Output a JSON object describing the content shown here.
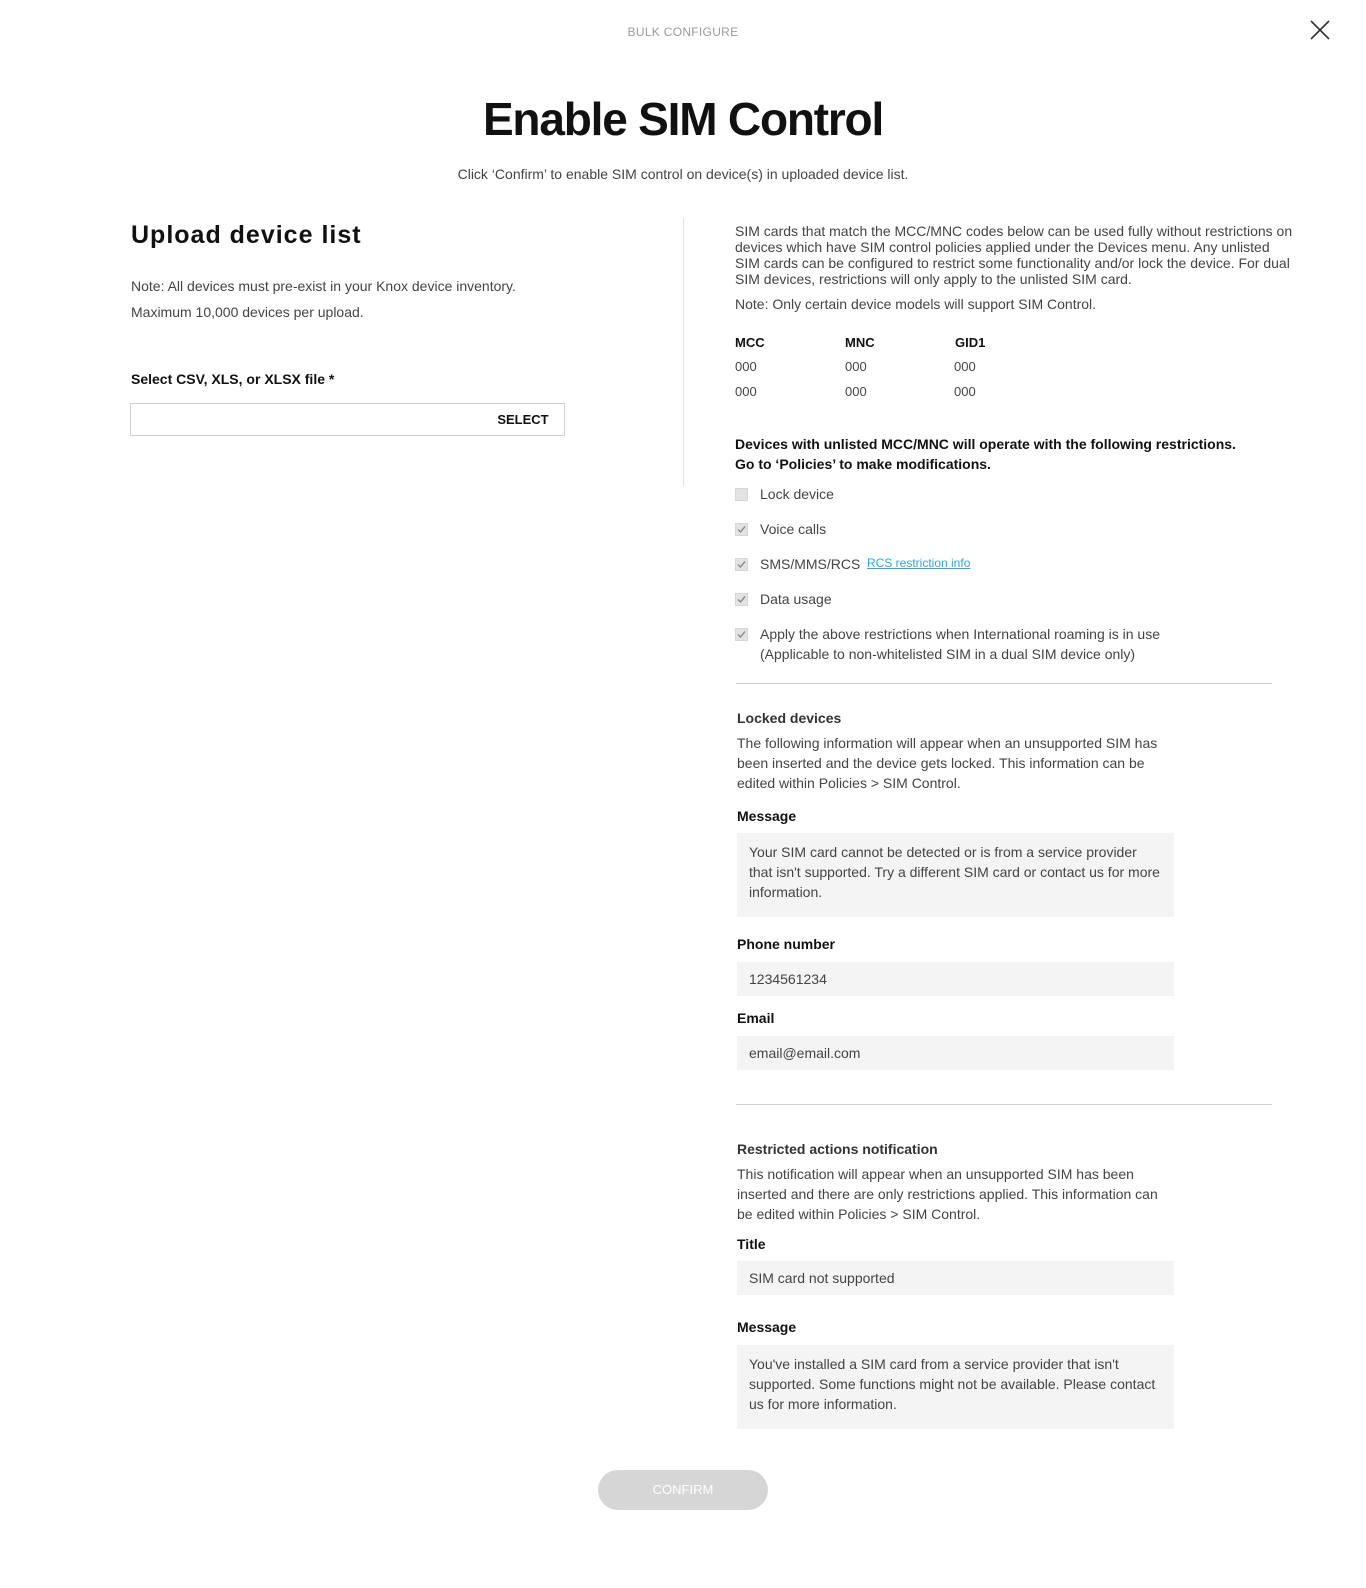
{
  "header": {
    "eyebrow": "BULK CONFIGURE",
    "title": "Enable SIM Control",
    "subtitle": "Click ‘Confirm’ to enable SIM control on device(s) in uploaded device list.",
    "close_icon": "close-icon"
  },
  "upload": {
    "heading": "Upload device list",
    "note1": "Note: All devices must pre-exist in your Knox device inventory.",
    "note2": "Maximum 10,000 devices per upload.",
    "file_label": "Select CSV, XLS, or XLSX file *",
    "file_value": "",
    "select_label": "SELECT"
  },
  "sim": {
    "intro": "SIM cards that match the MCC/MNC codes below can be used fully without restrictions on devices which have SIM control policies applied under the Devices menu. Any unlisted SIM cards can be configured to restrict some functionality and/or lock the device. For dual SIM devices, restrictions will only apply to the unlisted SIM card.",
    "note": "Note: Only certain device models will support SIM Control.",
    "table": {
      "headers": [
        "MCC",
        "MNC",
        "GID1"
      ],
      "rows": [
        [
          "000",
          "000",
          "000"
        ],
        [
          "000",
          "000",
          "000"
        ]
      ]
    }
  },
  "restrictions": {
    "heading_line1": "Devices with unlisted MCC/MNC will operate with the following restrictions.",
    "heading_line2": "Go to ‘Policies’ to make modifications.",
    "items": [
      {
        "label": "Lock device",
        "checked": false
      },
      {
        "label": "Voice calls",
        "checked": true
      },
      {
        "label": "SMS/MMS/RCS",
        "checked": true
      },
      {
        "label": "Data usage",
        "checked": true
      },
      {
        "label": "Apply the above restrictions when International roaming is in use",
        "sublabel": "(Applicable to non-whitelisted SIM in a dual SIM device only)",
        "checked": true
      }
    ],
    "rcs_link": "RCS restriction info"
  },
  "locked": {
    "title": "Locked devices",
    "desc": "The following information will appear when an unsupported SIM has been inserted and the device gets locked. This information can be edited within Policies > SIM Control.",
    "message_label": "Message",
    "message_value": "Your SIM card cannot be detected or is from a service provider that isn't supported. Try a different SIM card or contact us for more information.",
    "phone_label": "Phone number",
    "phone_value": "1234561234",
    "email_label": "Email",
    "email_value": "email@email.com"
  },
  "notification": {
    "title": "Restricted actions notification",
    "desc": "This notification will appear when an unsupported SIM has been inserted and there are only restrictions applied. This information can be edited within Policies > SIM Control.",
    "title_label": "Title",
    "title_value": "SIM card not supported",
    "message_label": "Message",
    "message_value": "You've installed a SIM card from a service provider that isn't supported. Some functions might not be available. Please contact us for more information."
  },
  "footer": {
    "confirm_label": "CONFIRM",
    "confirm_enabled": false
  }
}
